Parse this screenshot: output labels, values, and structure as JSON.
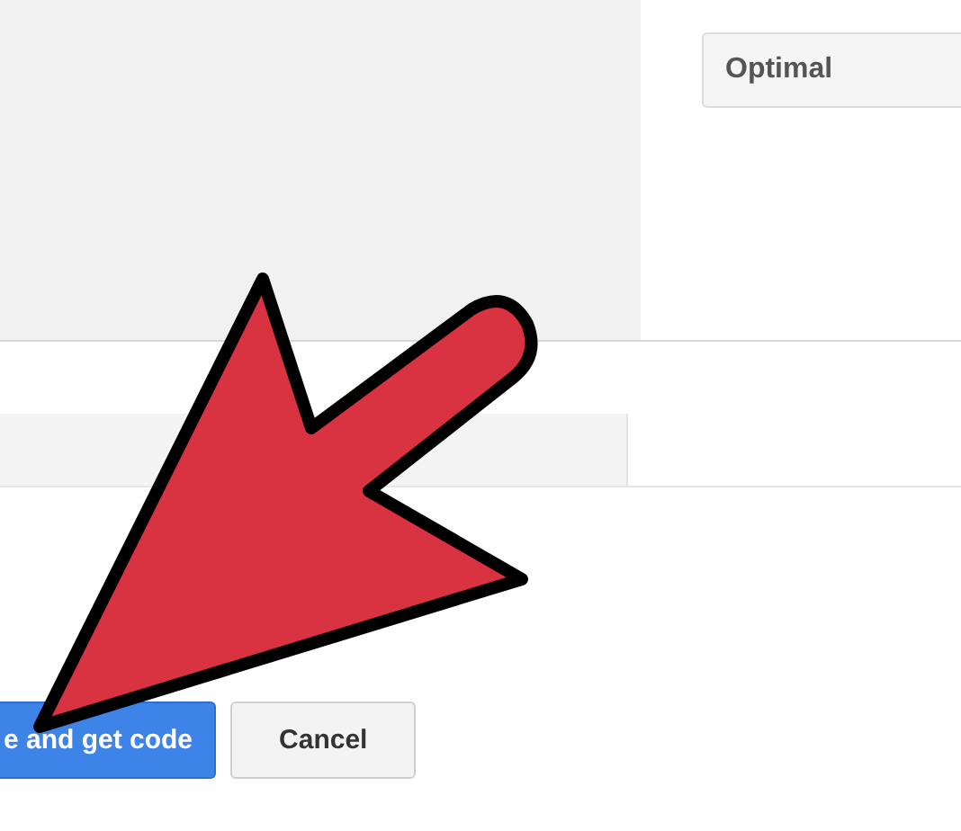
{
  "font_select": {
    "value": "Optimal"
  },
  "buttons": [
    {
      "label": "e and get code",
      "kind": "primary"
    },
    {
      "label": "Cancel",
      "kind": "secondary"
    }
  ]
}
